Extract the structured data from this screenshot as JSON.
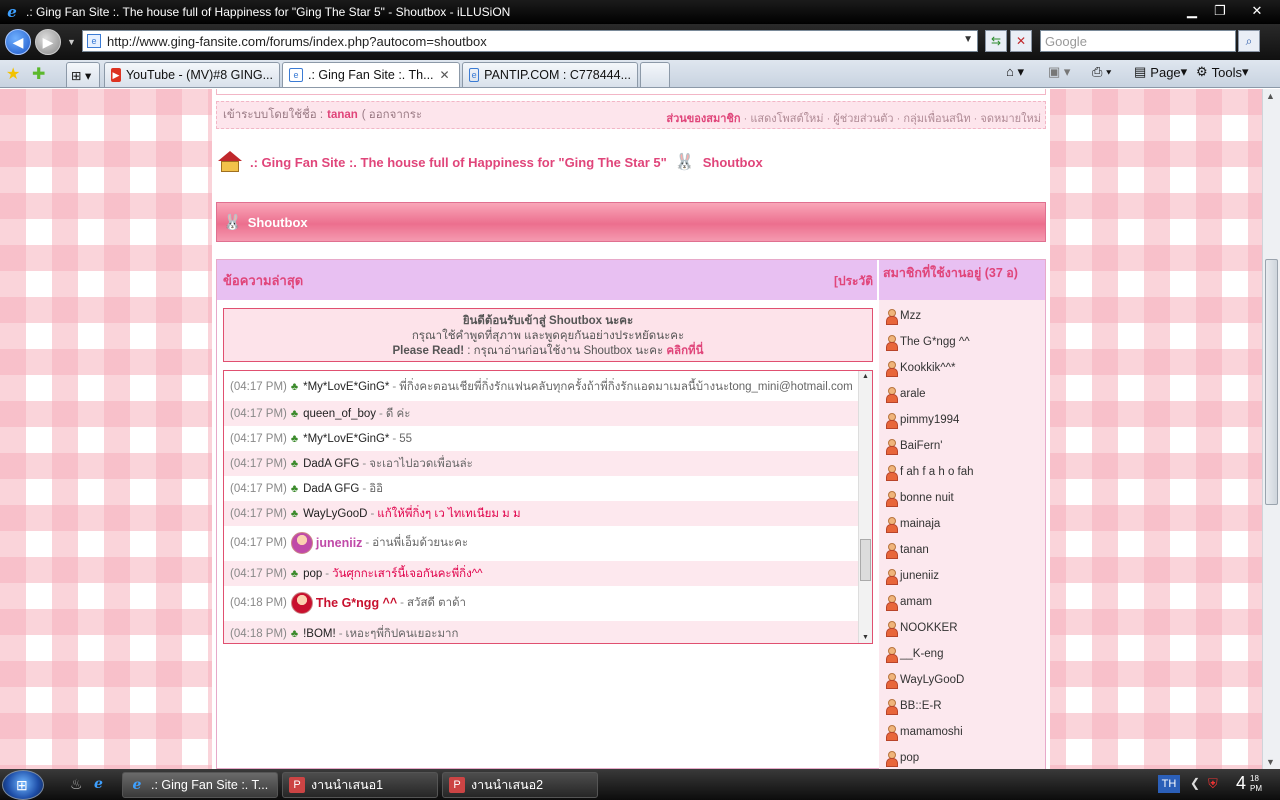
{
  "window": {
    "title": ".: Ging Fan Site :. The house full of Happiness for \"Ging The Star 5\" - Shoutbox - iLLUSiON",
    "minimize": "▁",
    "maximize": "❐",
    "close": "✕"
  },
  "address_bar": {
    "url": "http://www.ging-fansite.com/forums/index.php?autocom=shoutbox",
    "search_placeholder": "Google"
  },
  "tabs": [
    {
      "label": "YouTube - (MV)#8 GING...",
      "icon": "youtube-icon"
    },
    {
      "label": ".: Ging Fan Site :. Th...",
      "icon": "ie-page-icon",
      "active": true
    },
    {
      "label": "PANTIP.COM : C778444...",
      "icon": "ie-page-icon"
    }
  ],
  "toolbar": {
    "page_label": "Page",
    "tools_label": "Tools"
  },
  "forum": {
    "login_prefix": "เข้าระบบโดยใช้ชื่อ :",
    "login_user": "tanan",
    "login_logout": "( ออกจากระ",
    "member_links_title": "ส่วนของสมาชิก",
    "member_links": "· แสดงโพสต์ใหม่ · ผู้ช่วยส่วนตัว · กลุ่มเพื่อนสนิท · จดหมายใหม่",
    "breadcrumb_site": ".: Ging Fan Site :. The house full of Happiness for \"Ging The Star 5\"",
    "breadcrumb_page": "Shoutbox",
    "section_title": "Shoutbox",
    "latest_header": "ข้อความล่าสุด",
    "history_link": "[ประวัติ",
    "online_header": "สมาชิกที่ใช้งานอยู่ (37 อ)",
    "welcome_line1": "ยินดีต้อนรับเข้าสู่ Shoutbox นะคะ",
    "welcome_line2": "กรุณาใช้คำพูดที่สุภาพ และพูดคุยกันอย่างประหยัดนะคะ",
    "welcome_read": "Please Read!",
    "welcome_line3": ": กรุณาอ่านก่อนใช้งาน Shoutbox นะคะ",
    "welcome_click": "คลิกที่นี่"
  },
  "messages": [
    {
      "time": "(04:17 PM)",
      "user": "*My*LovE*GinG*",
      "text": "พี่กิ่งคะตอนเชียพี่กิ่งรักแฟนคลับทุกครั้งถ้าพี่กิ่งรักแอดมาเมลนี้บ้างนะtong_mini@hotmail.com",
      "red": false,
      "avatar": false
    },
    {
      "time": "(04:17 PM)",
      "user": "queen_of_boy",
      "text": "ดี ค่ะ",
      "red": false,
      "avatar": false
    },
    {
      "time": "(04:17 PM)",
      "user": "*My*LovE*GinG*",
      "text": "55",
      "red": false,
      "avatar": false
    },
    {
      "time": "(04:17 PM)",
      "user": "DadA GFG",
      "text": "จะเอาไปอวดเพื่อนล่ะ",
      "red": false,
      "avatar": false
    },
    {
      "time": "(04:17 PM)",
      "user": "DadA GFG",
      "text": "อิอิ",
      "red": false,
      "avatar": false
    },
    {
      "time": "(04:17 PM)",
      "user": "WayLyGooD",
      "text": "แก้ให้พี่กิ่งๆ เว ไทเทเนียม ม ม",
      "red": true,
      "avatar": false
    },
    {
      "time": "(04:17 PM)",
      "user": "juneniiz",
      "text": "อ่านพี่เอ็มด้วยนะคะ",
      "red": false,
      "avatar": true,
      "user_color": "#c04aa8"
    },
    {
      "time": "(04:17 PM)",
      "user": "pop",
      "text": "วันศุกกะเสาร์นี้เจอกันคะพี่กิ่ง^^",
      "red": true,
      "avatar": false
    },
    {
      "time": "(04:18 PM)",
      "user": "The G*ngg ^^",
      "text": "สวัสดี ตาด้า",
      "red": false,
      "avatar": true,
      "user_color": "#c8102e"
    },
    {
      "time": "(04:18 PM)",
      "user": "!BOM!",
      "text": "เหอะๆพี่กิปคนเยอะมาก",
      "red": false,
      "avatar": false
    }
  ],
  "members": [
    "Mzz",
    "The G*ngg ^^",
    "Kookkik^^*",
    "arale",
    "pimmy1994",
    "BaiFern'",
    "f ah f a h o fah",
    "bonne nuit",
    "mainaja",
    "tanan",
    "juneniiz",
    "amam",
    "NOOKKER",
    "__K-eng",
    "WayLyGooD",
    "BB::E-R",
    "mamamoshi",
    "pop"
  ],
  "taskbar": {
    "tasks": [
      ".: Ging Fan Site :. T...",
      "งานนำเสนอ1",
      "งานนำเสนอ2"
    ],
    "language": "TH",
    "clock_hour": "4",
    "clock_min": "18",
    "clock_ampm": "PM"
  }
}
